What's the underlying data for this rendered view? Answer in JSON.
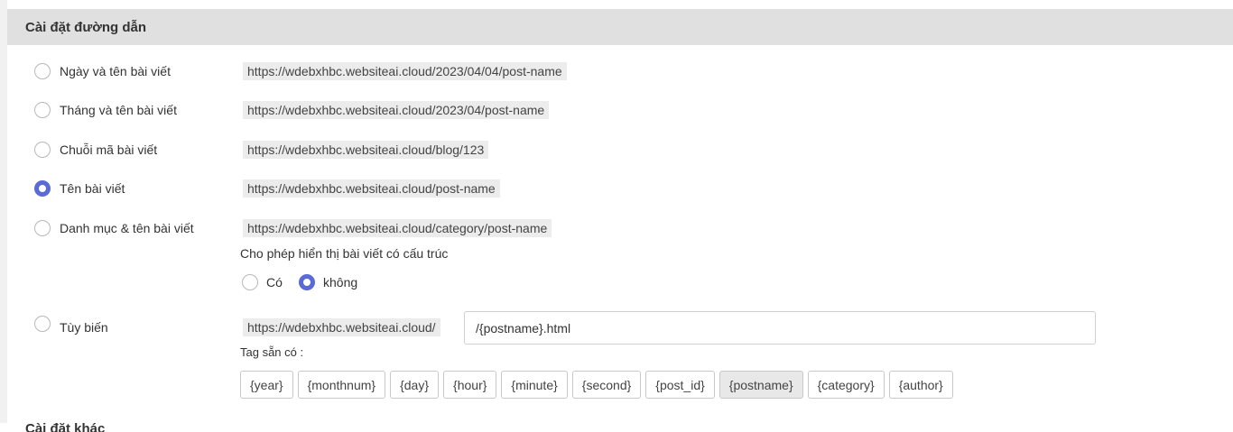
{
  "panel": {
    "title": "Cài đặt đường dẫn"
  },
  "options": [
    {
      "label": "Ngày và tên bài viết",
      "url": "https://wdebxhbc.websiteai.cloud/2023/04/04/post-name",
      "checked": false
    },
    {
      "label": "Tháng và tên bài viết",
      "url": "https://wdebxhbc.websiteai.cloud/2023/04/post-name",
      "checked": false
    },
    {
      "label": "Chuỗi mã bài viết",
      "url": "https://wdebxhbc.websiteai.cloud/blog/123",
      "checked": false
    },
    {
      "label": "Tên bài viết",
      "url": "https://wdebxhbc.websiteai.cloud/post-name",
      "checked": true
    },
    {
      "label": "Danh mục & tên bài viết",
      "url": "https://wdebxhbc.websiteai.cloud/category/post-name",
      "checked": false
    }
  ],
  "structure": {
    "title": "Cho phép hiển thị bài viết có cấu trúc",
    "yes_label": "Có",
    "no_label": "không",
    "selected": "no"
  },
  "custom": {
    "label": "Tùy biến",
    "base_url": "https://wdebxhbc.websiteai.cloud/",
    "value": "/{postname}.html",
    "checked": false
  },
  "tags": {
    "title": "Tag sẵn có :",
    "items": [
      "{year}",
      "{monthnum}",
      "{day}",
      "{hour}",
      "{minute}",
      "{second}",
      "{post_id}",
      "{postname}",
      "{category}",
      "{author}"
    ],
    "active": "{postname}"
  },
  "next_section": {
    "title": "Cài đặt khác"
  },
  "colors": {
    "accent": "#5a6ad6",
    "header_bg": "#e0e0e0",
    "url_bg": "#ececec"
  }
}
